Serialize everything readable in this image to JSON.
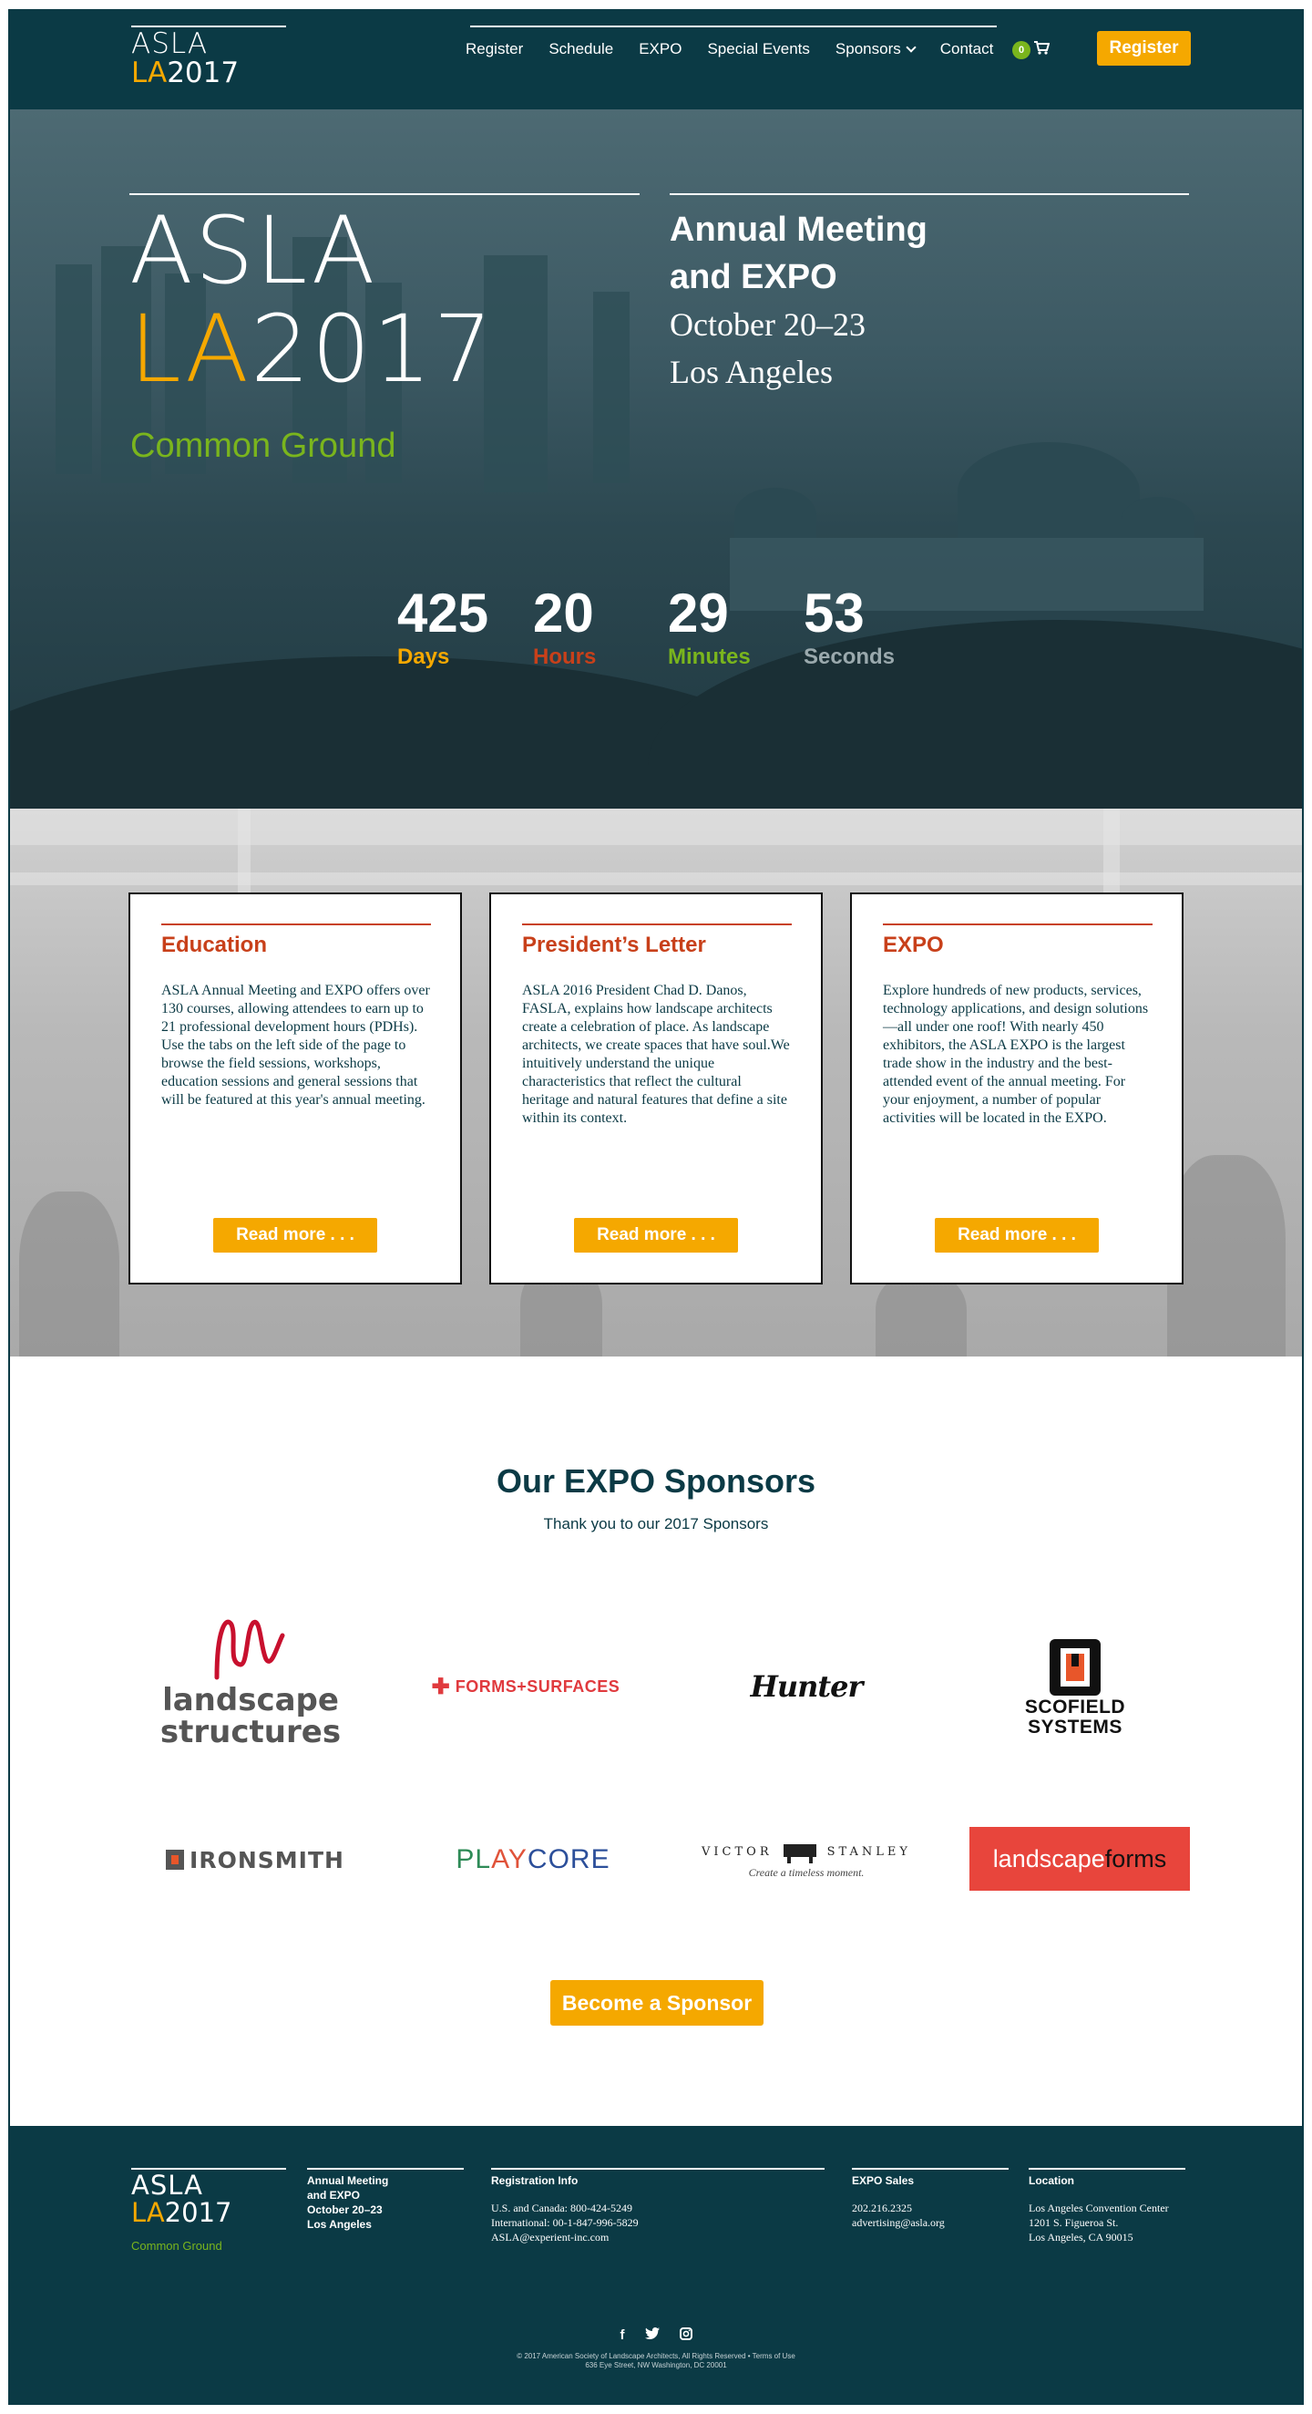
{
  "header": {
    "logo_line1": "ASLA",
    "logo_la": "LA",
    "logo_year": "2017",
    "nav": [
      "Register",
      "Schedule",
      "EXPO",
      "Special Events",
      "Sponsors",
      "Contact"
    ],
    "cart_count": "0",
    "cart_icon": "cart-icon",
    "register_label": "Register"
  },
  "hero": {
    "logo_line1": "ASLA",
    "logo_la": "LA",
    "logo_year": "2017",
    "tagline": "Common Ground",
    "event_title": "Annual Meeting\nand EXPO",
    "event_date": "October 20–23",
    "event_city": "Los Angeles",
    "countdown": [
      {
        "value": "425",
        "label": "Days",
        "color": "#f5a800"
      },
      {
        "value": "20",
        "label": "Hours",
        "color": "#c8401a"
      },
      {
        "value": "29",
        "label": "Minutes",
        "color": "#7ab51d"
      },
      {
        "value": "53",
        "label": "Seconds",
        "color": "#9aa9ad"
      }
    ]
  },
  "cards": [
    {
      "title": "Education",
      "body": "ASLA Annual Meeting and EXPO offers over 130 courses, allowing attendees to earn up to 21 professional development hours (PDHs).  Use the tabs on the left side of the page to browse the field sessions, workshops, education sessions and general sessions that will be featured at this year's annual meeting.",
      "button": "Read more . . ."
    },
    {
      "title": "President’s Letter",
      "body": "ASLA 2016 President Chad D. Danos, FASLA, explains how landscape architects create a celebration of place. As landscape architects, we create spaces that have soul.We intuitively understand the unique characteristics that reflect the cultural heritage and natural features that define a site within its context.",
      "button": "Read more . . ."
    },
    {
      "title": "EXPO",
      "body": "Explore hundreds of new products, services, technology applications, and design solutions—all under one roof! With nearly 450 exhibitors, the ASLA EXPO is the largest trade show in the industry and the best-attended event of the annual meeting. For your enjoyment, a number of popular activities will be located in the EXPO.",
      "button": "Read more . . ."
    }
  ],
  "sponsors": {
    "title": "Our EXPO Sponsors",
    "subtitle": "Thank you to our 2017 Sponsors",
    "logos": {
      "landscape_structures": [
        "landscape",
        "structures"
      ],
      "forms_surfaces": "FORMS+SURFACES",
      "hunter": "Hunter",
      "scofield": [
        "SCOFIELD",
        "SYSTEMS"
      ],
      "ironsmith": "IRONSMITH",
      "playcore": [
        "PL",
        "AY",
        "CORE"
      ],
      "victor_stanley": [
        "VICTOR",
        "STANLEY",
        "Create a timeless moment."
      ],
      "landscapeforms": [
        "landscape",
        "forms"
      ]
    },
    "button": "Become a Sponsor",
    "colors": {
      "accent": "#f5a800",
      "brand": "#0b3a45"
    }
  },
  "footer": {
    "logo_line1": "ASLA",
    "logo_la": "LA",
    "logo_year": "2017",
    "tagline": "Common Ground",
    "meeting_title": [
      "Annual Meeting",
      "and EXPO"
    ],
    "meeting_date": "October 20–23",
    "meeting_city": "Los Angeles",
    "registration": {
      "heading": "Registration Info",
      "lines": [
        "U.S. and Canada: 800-424-5249",
        "International: 00-1-847-996-5829",
        "ASLA@experient-inc.com"
      ]
    },
    "expo_sales": {
      "heading": "EXPO Sales",
      "lines": [
        "202.216.2325",
        "advertising@asla.org"
      ]
    },
    "location": {
      "heading": "Location",
      "lines": [
        "Los Angeles Convention Center",
        "1201 S. Figueroa St.",
        "Los Angeles, CA 90015"
      ]
    },
    "social": [
      "f",
      "t",
      "i"
    ],
    "social_icons": [
      "facebook-icon",
      "twitter-icon",
      "instagram-icon"
    ],
    "copyright": "© 2017 American Society of Landscape Architects, All Rights Reserved  •  Terms of Use",
    "address": "636 Eye Street, NW Washington, DC 20001"
  }
}
